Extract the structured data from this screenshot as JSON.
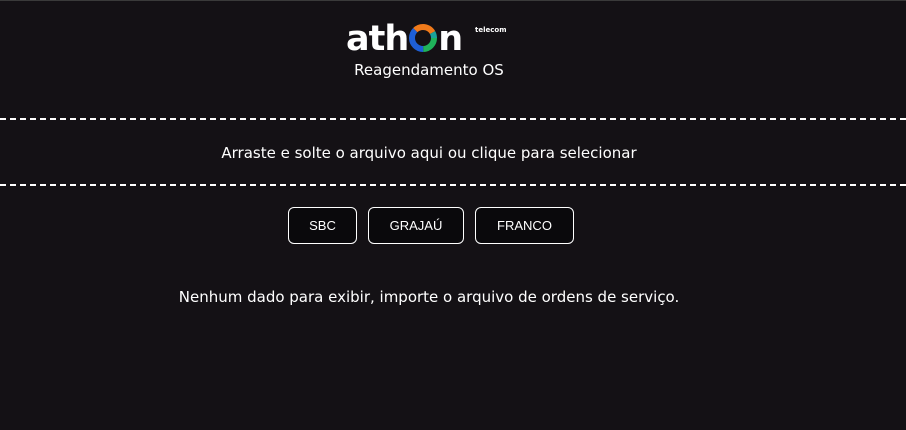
{
  "brand": {
    "logo_prefix": "ath",
    "logo_suffix": "n",
    "logo_sub": "telecom",
    "colors": {
      "ring_orange": "#f07a1a",
      "ring_blue": "#1e5fd6",
      "ring_green": "#1fb35a",
      "ring_teal": "#1aa39a"
    }
  },
  "header": {
    "subtitle": "Reagendamento OS"
  },
  "dropzone": {
    "label": "Arraste e solte o arquivo aqui ou clique para selecionar"
  },
  "filters": [
    {
      "label": "SBC"
    },
    {
      "label": "GRAJAÚ"
    },
    {
      "label": "FRANCO"
    }
  ],
  "content": {
    "empty_message": "Nenhum dado para exibir, importe o arquivo de ordens de serviço."
  },
  "theme": {
    "background": "#141115",
    "text": "#ffffff"
  }
}
